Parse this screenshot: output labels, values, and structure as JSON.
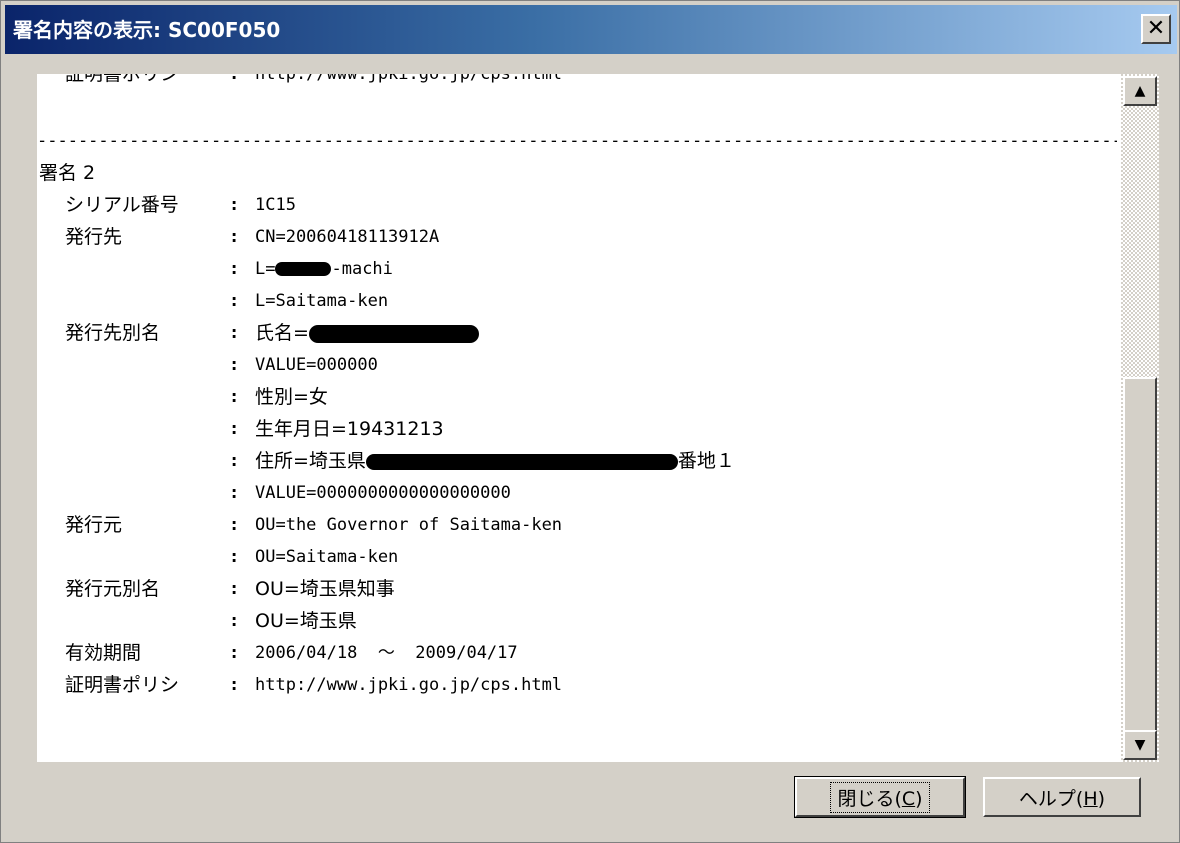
{
  "window": {
    "title": "署名内容の表示: SC00F050",
    "close_glyph": "✕"
  },
  "content": {
    "cut_line": {
      "label": "証明書ポリシ",
      "sep": ":",
      "value": "http://www.jpki.go.jp/cps.html"
    },
    "separator": "------------------------------------------------------------------------------------------------------------------------------------------------------------",
    "header": "署名 2",
    "serial": {
      "label": "シリアル番号",
      "sep": ":",
      "value": "1C15"
    },
    "issued_to": {
      "label": "発行先",
      "sep": ":",
      "values": [
        "CN=20060418113912A",
        "L=",
        "-machi",
        "L=Saitama-ken"
      ]
    },
    "issued_to_alt": {
      "label": "発行先別名",
      "sep": ":",
      "name_prefix": "氏名=",
      "values": [
        "VALUE=000000",
        "性別=女",
        "生年月日=19431213"
      ],
      "address_prefix": "住所=埼玉県",
      "address_suffix": "番地１",
      "value2": "VALUE=0000000000000000000"
    },
    "issuer": {
      "label": "発行元",
      "sep": ":",
      "values": [
        "OU=the Governor of Saitama-ken",
        "OU=Saitama-ken"
      ]
    },
    "issuer_alt": {
      "label": "発行元別名",
      "sep": ":",
      "values": [
        "OU=埼玉県知事",
        "OU=埼玉県"
      ]
    },
    "validity": {
      "label": "有効期間",
      "sep": ":",
      "value": "2006/04/18  ～  2009/04/17"
    },
    "policy": {
      "label": "証明書ポリシ",
      "sep": ":",
      "value": "http://www.jpki.go.jp/cps.html"
    }
  },
  "scroll": {
    "up_glyph": "▲",
    "down_glyph": "▼"
  },
  "buttons": {
    "close_label": "閉じる(",
    "close_key": "C",
    "close_end": ")",
    "help_label": "ヘルプ(",
    "help_key": "H",
    "help_end": ")"
  }
}
